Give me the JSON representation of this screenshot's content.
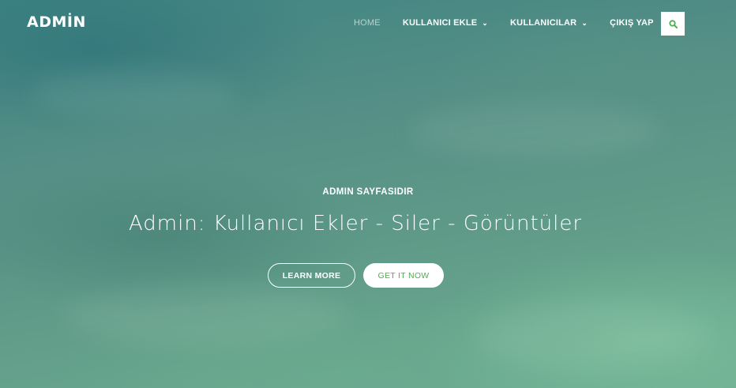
{
  "brand": {
    "name": "ADMİN"
  },
  "nav": {
    "items": [
      {
        "label": "HOME",
        "active": true,
        "dropdown": false
      },
      {
        "label": "KULLANICI EKLE",
        "active": false,
        "dropdown": true
      },
      {
        "label": "KULLANICILAR",
        "active": false,
        "dropdown": true
      },
      {
        "label": "ÇIKIŞ YAP",
        "active": false,
        "dropdown": false
      }
    ],
    "dropdown_glyph": "⌄",
    "search_icon": "search-icon"
  },
  "hero": {
    "kicker": "ADMIN SAYFASIDIR",
    "headline": "Admin: Kullanıcı Ekler - Siler - Görüntüler",
    "primary_button": "LEARN MORE",
    "secondary_button": "GET IT NOW"
  },
  "colors": {
    "accent": "#4cb050",
    "background": "#5f9887",
    "text": "#ffffff"
  }
}
